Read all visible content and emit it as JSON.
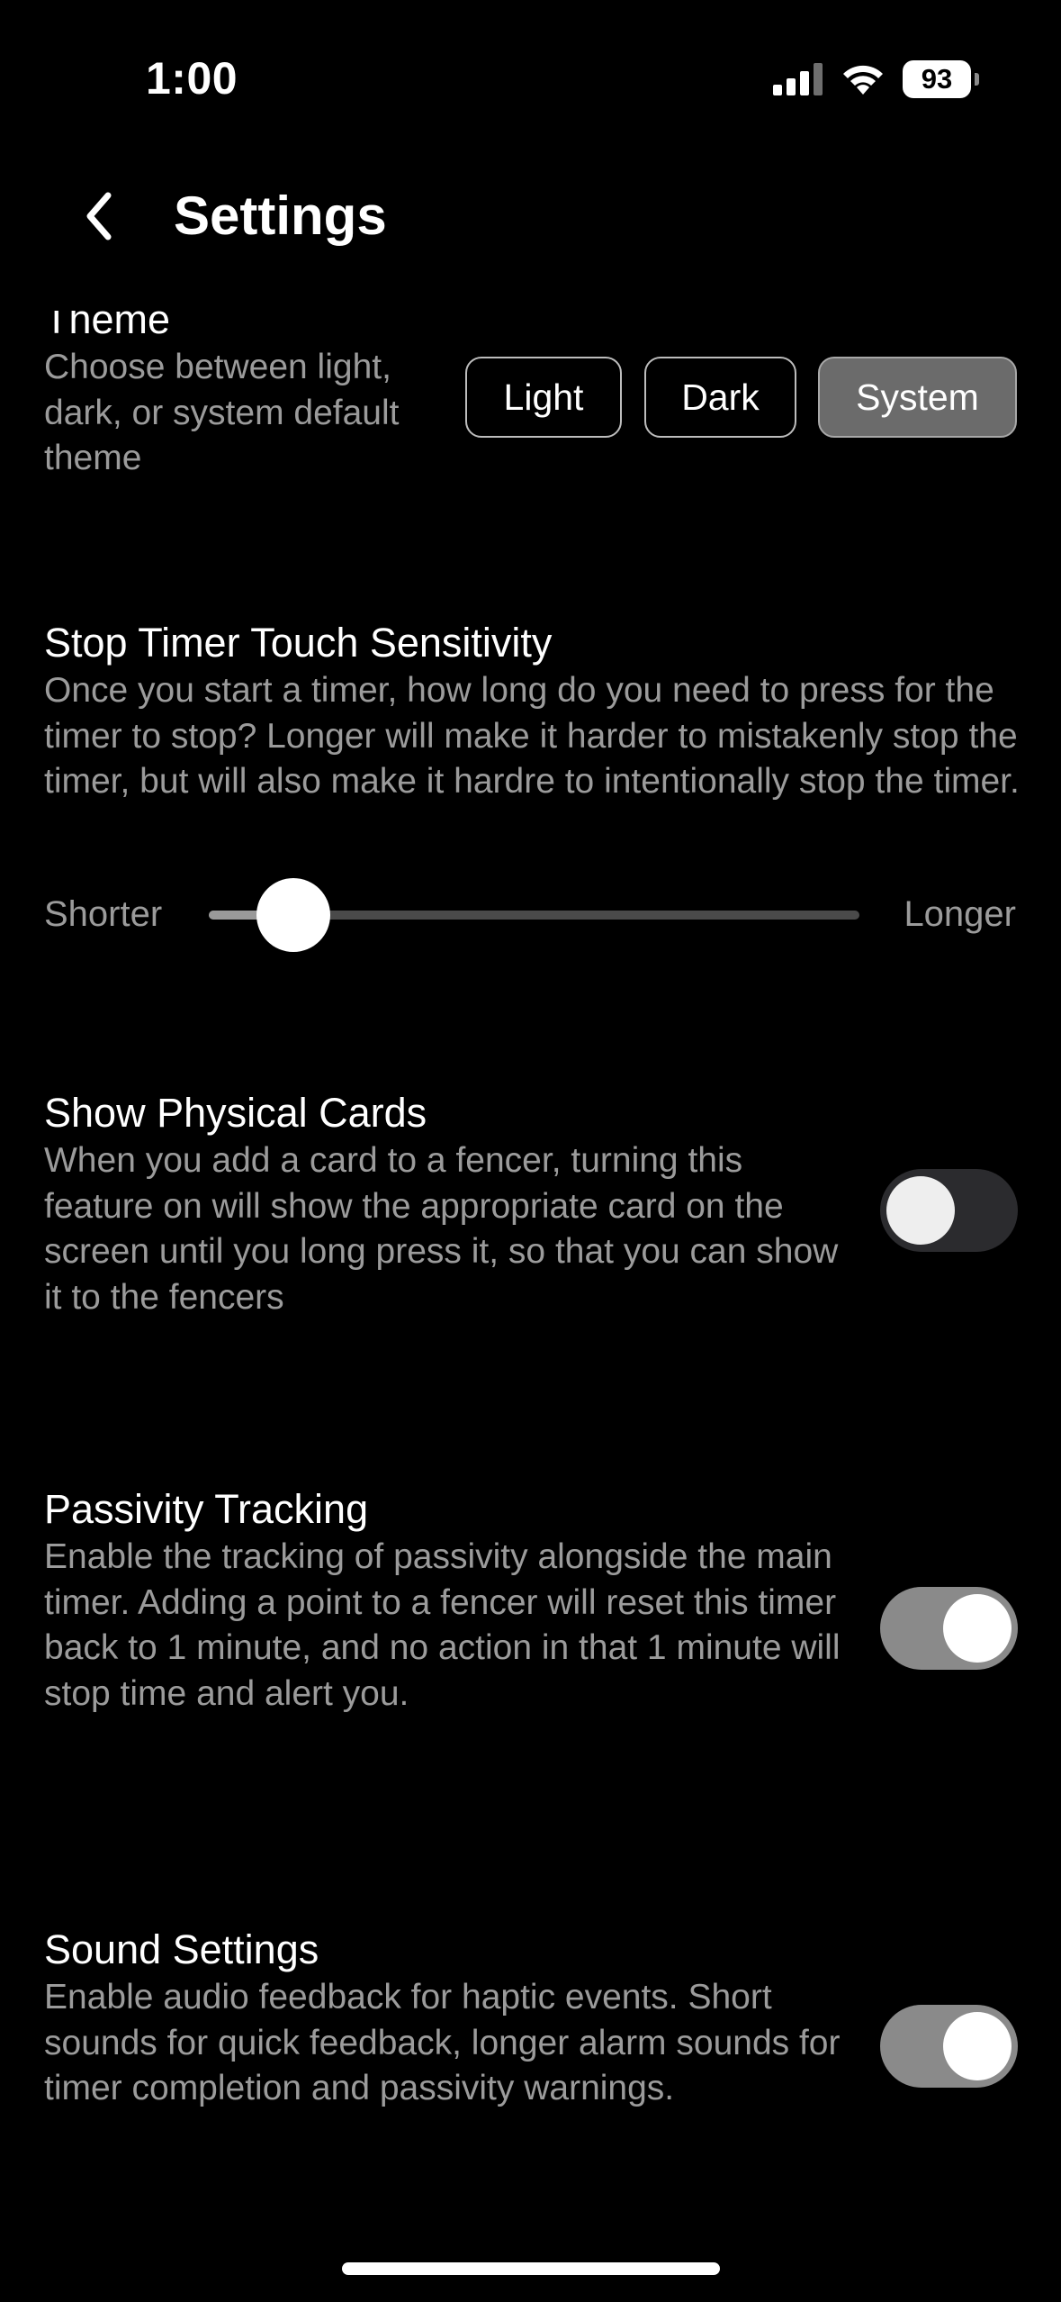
{
  "status_bar": {
    "time": "1:00",
    "battery": "93",
    "icons": [
      "cellular-signal-icon",
      "wifi-icon",
      "battery-icon"
    ]
  },
  "header": {
    "title": "Settings",
    "back_icon": "chevron-left-icon"
  },
  "theme": {
    "title": "Theme",
    "description": "Choose between light, dark, or system default theme",
    "options": [
      "Light",
      "Dark",
      "System"
    ],
    "selected": "System"
  },
  "stop_timer": {
    "title": "Stop Timer Touch Sensitivity",
    "description": "Once you start a timer, how long do you need to press for the timer to stop? Longer will make it harder to mistakenly stop the timer, but will also make it hardre to intentionally stop the timer.",
    "min_label": "Shorter",
    "max_label": "Longer",
    "value_fraction": 0.13
  },
  "physical_cards": {
    "title": "Show Physical Cards",
    "description": "When you add a card to a fencer, turning this feature on will show the appropriate card on the screen until you long press it, so that you can show it to the fencers",
    "enabled": false
  },
  "passivity": {
    "title": "Passivity Tracking",
    "description": "Enable the tracking of passivity alongside the main timer. Adding a point to a fencer will reset this timer back to 1 minute, and no action in that 1 minute will stop time and alert you.",
    "enabled": true
  },
  "sound": {
    "title": "Sound Settings",
    "description": "Enable audio feedback for haptic events. Short sounds for quick feedback, longer alarm sounds for timer completion and passivity warnings.",
    "enabled": true
  },
  "colors": {
    "background": "#000000",
    "text": "#ffffff",
    "secondary_text": "#9b9b9b",
    "toggle_on": "#8a8a8a",
    "toggle_off": "#2b2b2e",
    "segment_selected": "#6b6b6b"
  }
}
